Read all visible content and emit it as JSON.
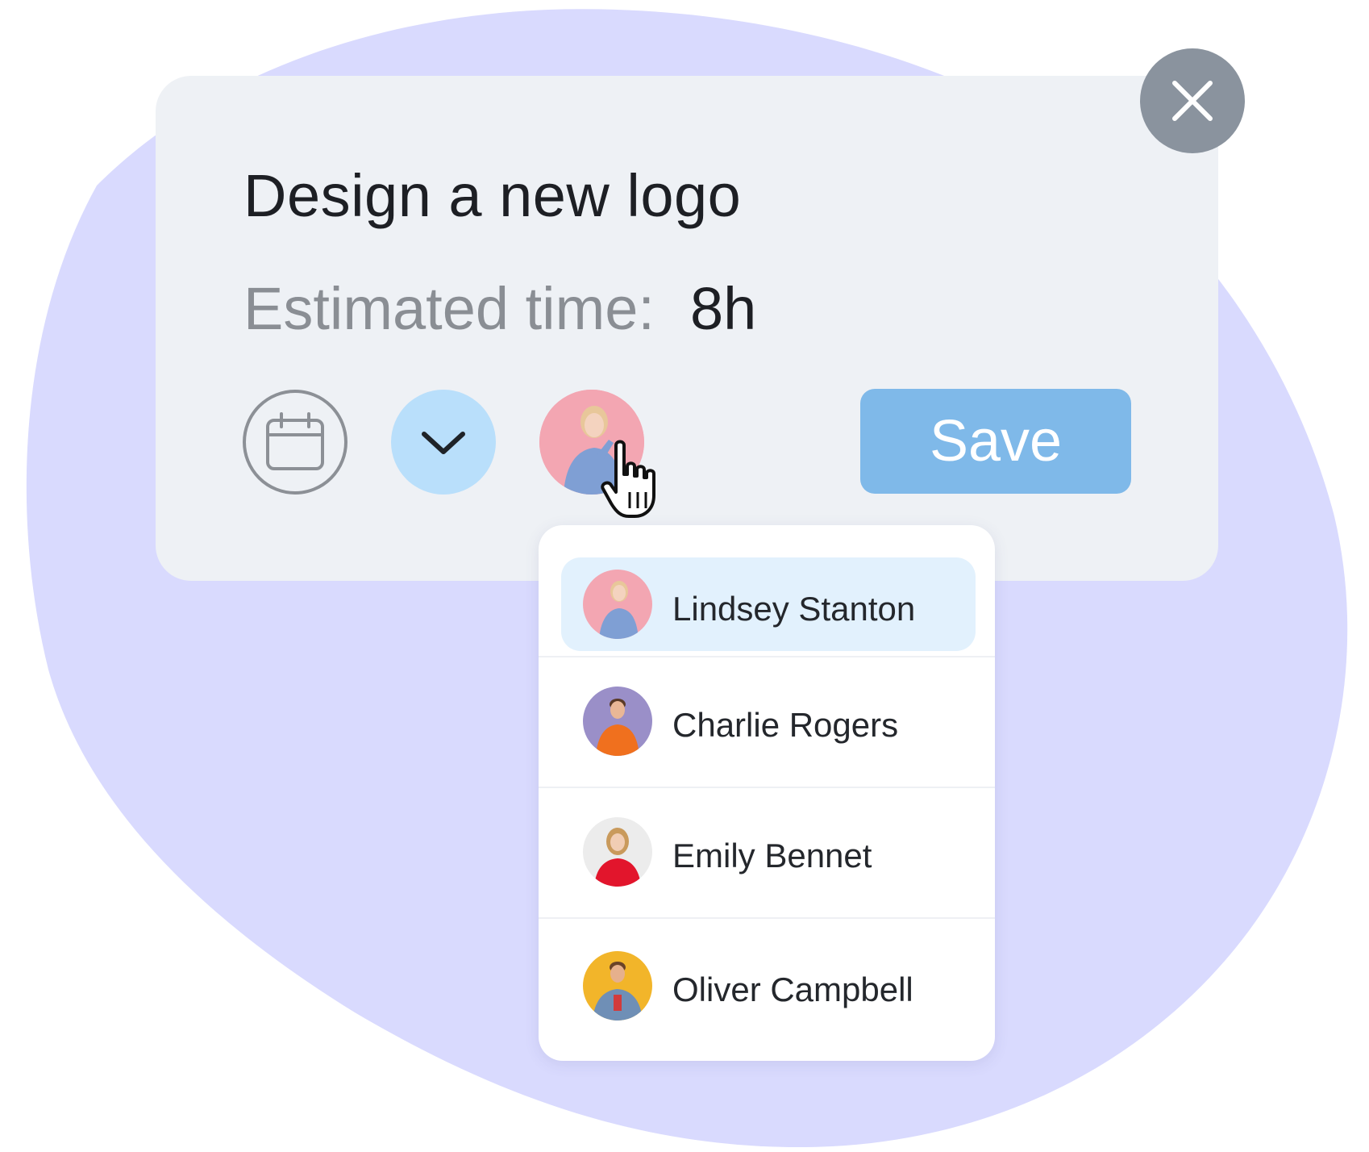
{
  "task": {
    "title": "Design a new logo",
    "estimate_label": "Estimated time:",
    "estimate_value": "8h"
  },
  "actions": {
    "save_label": "Save"
  },
  "assignees": [
    {
      "name": "Lindsey Stanton",
      "selected": true,
      "avatar_bg": "#f3a6b2",
      "shirt": "#7f9fd4"
    },
    {
      "name": "Charlie Rogers",
      "selected": false,
      "avatar_bg": "#9a8fc8",
      "shirt": "#f0701e"
    },
    {
      "name": "Emily Bennet",
      "selected": false,
      "avatar_bg": "#ececec",
      "shirt": "#e2152c"
    },
    {
      "name": "Oliver Campbell",
      "selected": false,
      "avatar_bg": "#f2b52a",
      "shirt": "#6f8fb6"
    }
  ],
  "colors": {
    "backdrop_blob": "#d9dafe",
    "card": "#eef1f5",
    "save_button": "#7fb9e9",
    "chevron_button": "#b9dffb",
    "close_button": "#8a939e",
    "selected_item": "#e2f1fd"
  },
  "icons": {
    "calendar": "calendar-icon",
    "chevron": "chevron-down-icon",
    "close": "close-icon",
    "cursor": "hand-pointer-icon"
  }
}
